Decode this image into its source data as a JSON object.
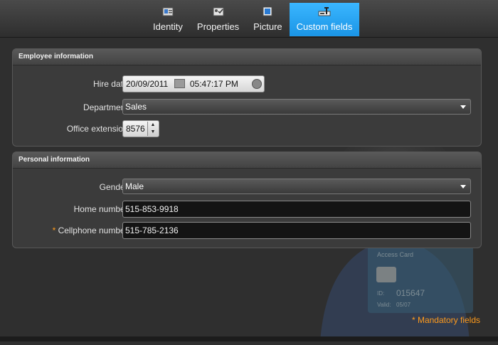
{
  "tabs": [
    {
      "label": "Identity",
      "icon": "identity-icon"
    },
    {
      "label": "Properties",
      "icon": "properties-icon"
    },
    {
      "label": "Picture",
      "icon": "picture-icon"
    },
    {
      "label": "Custom fields",
      "icon": "custom-fields-icon",
      "active": true
    }
  ],
  "employee": {
    "title": "Employee information",
    "hire_date_label": "Hire date:",
    "hire_date": "20/09/2011",
    "hire_time": "05:47:17 PM",
    "department_label": "Department:",
    "department": "Sales",
    "office_ext_label": "Office extension:",
    "office_ext": "8576"
  },
  "personal": {
    "title": "Personal information",
    "gender_label": "Gender:",
    "gender": "Male",
    "home_label": "Home number:",
    "home": "515-853-9918",
    "cell_star": "*",
    "cell_label": "Cellphone number:",
    "cell": "515-785-2136"
  },
  "card": {
    "title": "Access Card",
    "id_label": "ID:",
    "id": "015647",
    "valid_label": "Valid:",
    "valid": "05/07"
  },
  "mandatory_note": "* Mandatory fields",
  "colors": {
    "accent": "#2aa6f5",
    "mandatory": "#ff9b1c"
  }
}
